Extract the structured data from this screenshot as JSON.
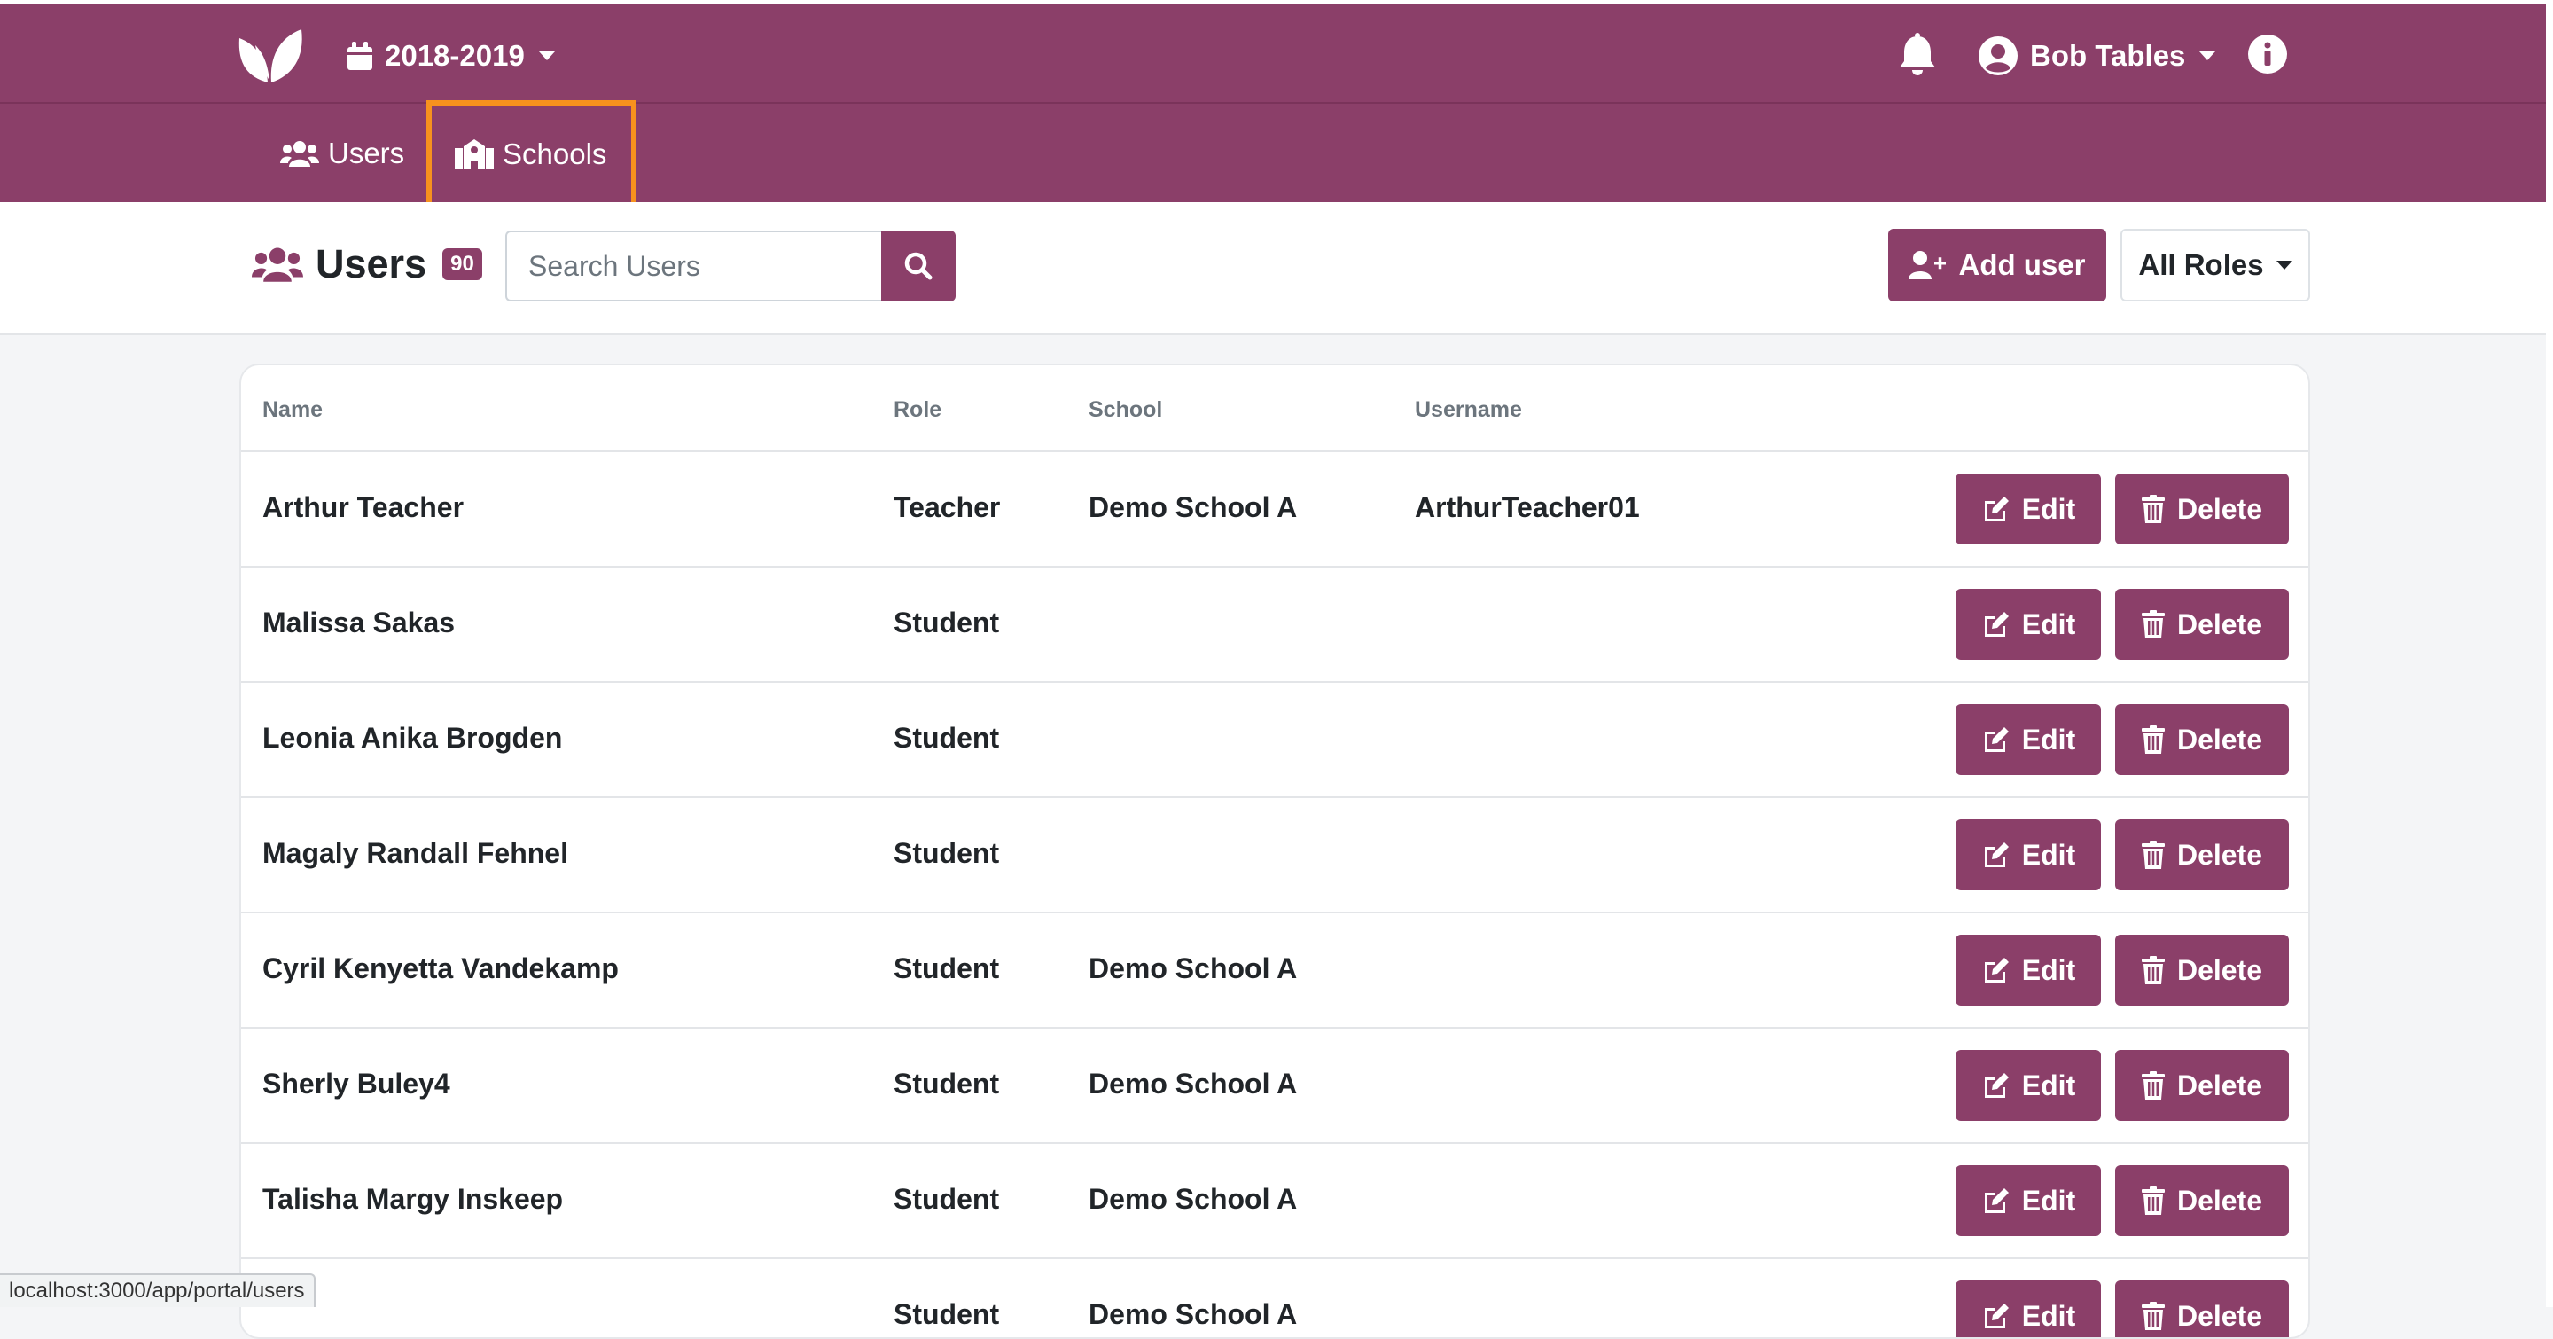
{
  "topbar": {
    "school_year": "2018-2019",
    "user_name": "Bob Tables"
  },
  "nav": {
    "users_label": "Users",
    "schools_label": "Schools"
  },
  "header": {
    "title": "Users",
    "count": "90",
    "search_placeholder": "Search Users",
    "add_user_label": "Add user",
    "roles_label": "All Roles"
  },
  "table": {
    "columns": [
      "Name",
      "Role",
      "School",
      "Username"
    ],
    "edit_label": "Edit",
    "delete_label": "Delete",
    "rows": [
      {
        "name": "Arthur Teacher",
        "role": "Teacher",
        "school": "Demo School A",
        "username": "ArthurTeacher01"
      },
      {
        "name": "Malissa Sakas",
        "role": "Student",
        "school": "",
        "username": ""
      },
      {
        "name": "Leonia Anika Brogden",
        "role": "Student",
        "school": "",
        "username": ""
      },
      {
        "name": "Magaly Randall Fehnel",
        "role": "Student",
        "school": "",
        "username": ""
      },
      {
        "name": "Cyril Kenyetta Vandekamp",
        "role": "Student",
        "school": "Demo School A",
        "username": ""
      },
      {
        "name": "Sherly Buley4",
        "role": "Student",
        "school": "Demo School A",
        "username": ""
      },
      {
        "name": "Talisha Margy Inskeep",
        "role": "Student",
        "school": "Demo School A",
        "username": ""
      },
      {
        "name": "",
        "role": "Student",
        "school": "Demo School A",
        "username": ""
      }
    ]
  },
  "status_bar": {
    "url": "localhost:3000/app/portal/users"
  },
  "colors": {
    "brand": "#8b3f69",
    "highlight": "#f7911e"
  },
  "icons": {
    "logo": "leaf-logo-icon",
    "calendar": "calendar-icon",
    "bell": "bell-icon",
    "user": "user-circle-icon",
    "info": "info-icon",
    "users": "users-icon",
    "school": "school-icon",
    "search": "search-icon",
    "add_user": "user-plus-icon",
    "edit": "edit-icon",
    "trash": "trash-icon"
  }
}
